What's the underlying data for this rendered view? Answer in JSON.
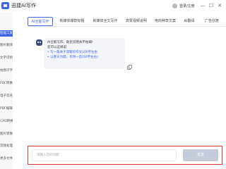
{
  "app": {
    "title": "迅捷AI写作",
    "login": "登录/注册",
    "window_buttons": [
      "—",
      "☐",
      "✕"
    ]
  },
  "sidebar": {
    "items": [
      {
        "label": "智能工具",
        "active": true
      },
      {
        "label": "图片翻译",
        "active": false
      },
      {
        "label": "文字识别",
        "active": false
      },
      {
        "label": "拍图识字",
        "active": false
      },
      {
        "label": "PDF转换",
        "active": false
      },
      {
        "label": "电子签名PDF",
        "active": false
      },
      {
        "label": "PDF编辑",
        "active": false
      },
      {
        "label": "CAD转换",
        "active": false
      },
      {
        "label": "图片转换",
        "active": false
      },
      {
        "label": "音频处理",
        "active": false
      },
      {
        "label": "更多文件",
        "active": false
      }
    ]
  },
  "tabs": [
    {
      "label": "AI全能写作",
      "active": true
    },
    {
      "label": "新媒体爆款标题",
      "active": false
    },
    {
      "label": "新媒体全文写作",
      "active": false
    },
    {
      "label": "高赞视频说明",
      "active": false
    },
    {
      "label": "电商种草文案",
      "active": false
    },
    {
      "label": "AI翻译",
      "active": false
    },
    {
      "label": "广告创意",
      "active": false
    }
  ],
  "chat": {
    "lines": [
      "AI全能写作，助您灵感永不枯竭!",
      "您可以这样说:"
    ],
    "examples": [
      "• 写一篇关于温暖的作文100字左右",
      "• 以春天为题，作诗一首(60字左右)"
    ]
  },
  "composer": {
    "placeholder": "请输入您的问题",
    "send_label": "发送"
  },
  "icons": {
    "logo": "logo-icon",
    "bot": "robot-icon",
    "copy": "copy-icon",
    "user": "user-avatar-icon"
  },
  "colors": {
    "accent": "#3f66ee",
    "highlight_border": "#e53935",
    "disabled_button": "#c5ccd9"
  }
}
